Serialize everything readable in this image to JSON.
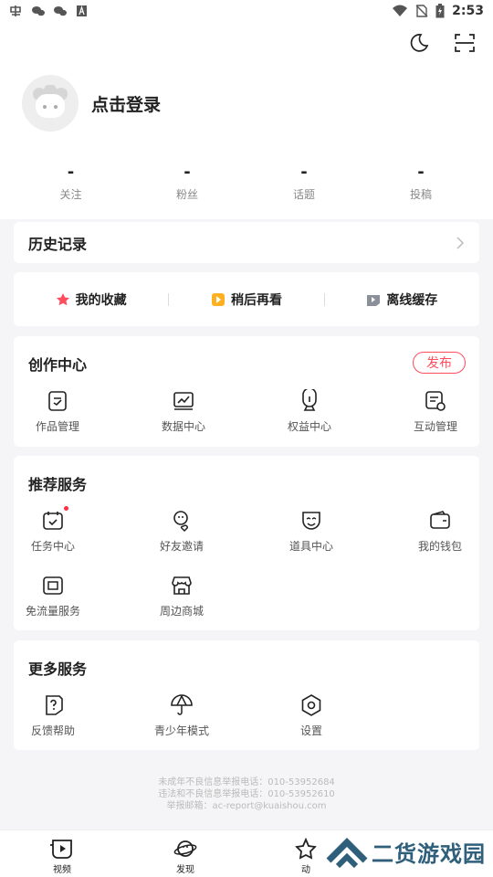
{
  "status_bar": {
    "time": "2:53",
    "left_icons": [
      "app-logo-icon",
      "wechat-icon",
      "wechat-icon",
      "notification-a-icon"
    ],
    "right_icons": [
      "wifi-icon",
      "no-sim-icon",
      "battery-icon"
    ]
  },
  "header": {
    "actions": [
      "night-mode-icon",
      "scan-icon"
    ]
  },
  "profile": {
    "login_label": "点击登录"
  },
  "stats": [
    {
      "value": "-",
      "label": "关注"
    },
    {
      "value": "-",
      "label": "粉丝"
    },
    {
      "value": "-",
      "label": "话题"
    },
    {
      "value": "-",
      "label": "投稿"
    }
  ],
  "history": {
    "title": "历史记录"
  },
  "quick_links": [
    {
      "label": "我的收藏",
      "icon": "star-icon",
      "color": "#ff4d5e"
    },
    {
      "label": "稍后再看",
      "icon": "play-later-icon",
      "color": "#ffb020"
    },
    {
      "label": "离线缓存",
      "icon": "download-icon",
      "color": "#8a8f99"
    }
  ],
  "create_center": {
    "title": "创作中心",
    "publish_label": "发布",
    "items": [
      {
        "label": "作品管理",
        "icon": "works-icon"
      },
      {
        "label": "数据中心",
        "icon": "data-chart-icon"
      },
      {
        "label": "权益中心",
        "icon": "badge-icon"
      },
      {
        "label": "互动管理",
        "icon": "interaction-icon"
      }
    ]
  },
  "recommend": {
    "title": "推荐服务",
    "items": [
      {
        "label": "任务中心",
        "icon": "calendar-check-icon",
        "dot": true
      },
      {
        "label": "好友邀请",
        "icon": "invite-friend-icon"
      },
      {
        "label": "道具中心",
        "icon": "mask-icon"
      },
      {
        "label": "我的钱包",
        "icon": "wallet-icon"
      },
      {
        "label": "免流量服务",
        "icon": "sim-card-icon"
      },
      {
        "label": "周边商城",
        "icon": "store-icon"
      }
    ]
  },
  "more": {
    "title": "更多服务",
    "items": [
      {
        "label": "反馈帮助",
        "icon": "help-icon"
      },
      {
        "label": "青少年模式",
        "icon": "umbrella-icon"
      },
      {
        "label": "设置",
        "icon": "settings-icon"
      }
    ]
  },
  "legal": {
    "line1": "未成年不良信息举报电话：010-53952684",
    "line2": "违法和不良信息举报电话：010-53952610",
    "line3": "举报邮箱：ac-report@kuaishou.com"
  },
  "tabbar": [
    {
      "label": "视频",
      "icon": "video-icon"
    },
    {
      "label": "发现",
      "icon": "planet-icon"
    },
    {
      "label": "动",
      "icon": "dynamic-icon"
    }
  ],
  "watermark": {
    "text": "二货游戏园"
  }
}
